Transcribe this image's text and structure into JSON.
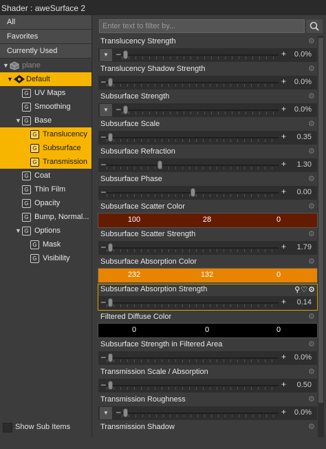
{
  "title": "Shader : aweSurface 2",
  "categories": [
    "All",
    "Favorites",
    "Currently Used"
  ],
  "tree": [
    {
      "label": "plane",
      "level": 0,
      "arrow": "▼",
      "icon": "cube-icon",
      "state": "dim"
    },
    {
      "label": "Default",
      "level": 1,
      "arrow": "▼",
      "icon": "material-icon",
      "state": "selected"
    },
    {
      "label": "UV Maps",
      "level": 2,
      "icon": "group-icon"
    },
    {
      "label": "Smoothing",
      "level": 2,
      "icon": "group-icon"
    },
    {
      "label": "Base",
      "level": 2,
      "arrow": "▼",
      "icon": "group-icon"
    },
    {
      "label": "Translucency",
      "level": 3,
      "icon": "group-icon",
      "state": "selected"
    },
    {
      "label": "Subsurface",
      "level": 3,
      "icon": "group-icon",
      "state": "selected"
    },
    {
      "label": "Transmission",
      "level": 3,
      "icon": "group-icon",
      "state": "selected"
    },
    {
      "label": "Coat",
      "level": 2,
      "icon": "group-icon"
    },
    {
      "label": "Thin Film",
      "level": 2,
      "icon": "group-icon"
    },
    {
      "label": "Opacity",
      "level": 2,
      "icon": "group-icon"
    },
    {
      "label": "Bump, Normal...",
      "level": 2,
      "icon": "group-icon"
    },
    {
      "label": "Options",
      "level": 2,
      "arrow": "▼",
      "icon": "group-icon"
    },
    {
      "label": "Mask",
      "level": 3,
      "icon": "group-icon"
    },
    {
      "label": "Visibility",
      "level": 3,
      "icon": "group-icon"
    }
  ],
  "show_sub_items": "Show Sub Items",
  "filter_placeholder": "Enter text to filter by...",
  "properties": [
    {
      "label": "Translucency Strength",
      "type": "slider",
      "dropdown": true,
      "value": "0.0%",
      "fraction": 0.0
    },
    {
      "label": "Translucency Shadow Strength",
      "type": "slider",
      "value": "0.0%",
      "fraction": 0.0
    },
    {
      "label": "Subsurface Strength",
      "type": "slider",
      "dropdown": true,
      "value": "0.0%",
      "fraction": 0.0
    },
    {
      "label": "Subsurface Scale",
      "type": "slider",
      "value": "0.35",
      "fraction": 0.0
    },
    {
      "label": "Subsurface Refraction",
      "type": "slider",
      "value": "1.30",
      "fraction": 0.3
    },
    {
      "label": "Subsurface Phase",
      "type": "slider",
      "value": "0.00",
      "fraction": 0.5
    },
    {
      "label": "Subsurface Scatter Color",
      "type": "color",
      "rgb": [
        "100",
        "28",
        "0"
      ],
      "color": "#641c00"
    },
    {
      "label": "Subsurface Scatter Strength",
      "type": "slider",
      "value": "1.79",
      "fraction": 0.0
    },
    {
      "label": "Subsurface Absorption Color",
      "type": "color",
      "rgb": [
        "232",
        "132",
        "0"
      ],
      "color": "#e88400"
    },
    {
      "label": "Subsurface Absorption Strength",
      "type": "slider",
      "value": "0.14",
      "fraction": 0.0,
      "highlight": true
    },
    {
      "label": "Filtered Diffuse Color",
      "type": "color",
      "rgb": [
        "0",
        "0",
        "0"
      ],
      "color": "#000000"
    },
    {
      "label": "Subsurface Strength in Filtered Area",
      "type": "slider",
      "value": "0.0%",
      "fraction": 0.0
    },
    {
      "label": "Transmission Scale / Absorption",
      "type": "slider",
      "value": "0.50",
      "fraction": 0.0
    },
    {
      "label": "Transmission Roughness",
      "type": "slider",
      "dropdown": true,
      "value": "0.0%",
      "fraction": 0.0
    },
    {
      "label": "Transmission Shadow",
      "type": "header"
    }
  ],
  "colors": {
    "accent": "#f7b500",
    "panel": "#3c3c3c",
    "row": "#2e2e2e"
  }
}
